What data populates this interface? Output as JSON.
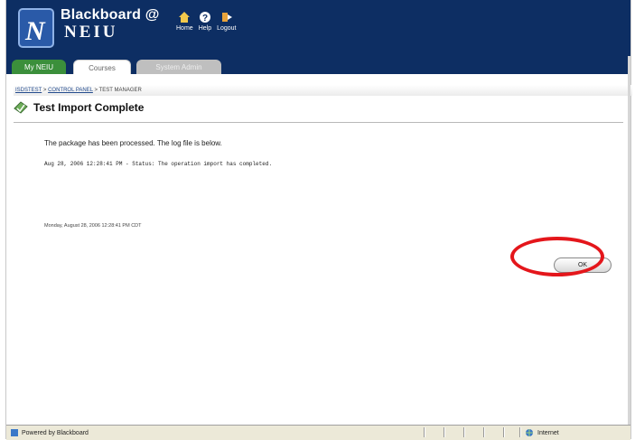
{
  "header": {
    "brand_top": "Blackboard @",
    "brand_bottom": "NEIU",
    "nav": [
      {
        "label": "Home",
        "icon": "home-icon"
      },
      {
        "label": "Help",
        "icon": "help-icon"
      },
      {
        "label": "Logout",
        "icon": "logout-icon"
      }
    ]
  },
  "tabs": [
    {
      "label": "My NEIU"
    },
    {
      "label": "Courses"
    },
    {
      "label": "System Admin"
    }
  ],
  "breadcrumb": {
    "item1": "ISDSTEST",
    "sep": " > ",
    "item2": "CONTROL PANEL",
    "item3": "TEST MANAGER"
  },
  "page": {
    "title": "Test Import Complete",
    "message": "The package has been processed. The log file is below.",
    "log": "Aug 28, 2006 12:28:41 PM - Status: The operation import has completed.",
    "timestamp": "Monday, August 28, 2006 12:28:41 PM CDT",
    "ok_label": "OK"
  },
  "statusbar": {
    "left": "Powered by Blackboard",
    "zone": "Internet"
  },
  "colors": {
    "header_bg": "#0d2e63",
    "tab_active": "#3b8f3b",
    "annotation_ring": "#e4161b"
  }
}
